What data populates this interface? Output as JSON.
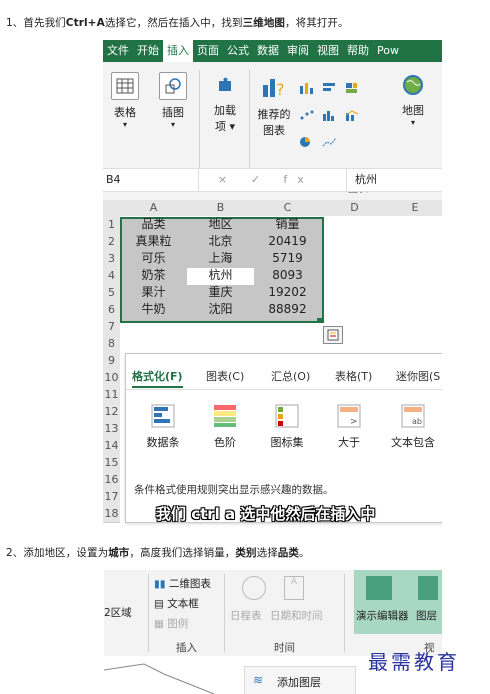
{
  "step1": {
    "prefix": "1、首先我们",
    "key1": "Ctrl+A",
    "mid1": "选择它，然后在插入中，找到",
    "key2": "三维地图",
    "suffix": "，将其打开。"
  },
  "ribbon_tabs": [
    "文件",
    "开始",
    "插入",
    "页面",
    "公式",
    "数据",
    "审阅",
    "视图",
    "帮助",
    "Pow"
  ],
  "ribbon": {
    "table": "表格",
    "illustration": "插图",
    "addin_1": "加载",
    "addin_2": "项 ▾",
    "recommended_chart_1": "推荐的",
    "recommended_chart_2": "图表",
    "map": "地图",
    "group_chart": "图表"
  },
  "formula_bar": {
    "namebox": "B4",
    "fx": "× ✓ fx",
    "value": "杭州"
  },
  "columns": [
    "A",
    "B",
    "C",
    "D",
    "E"
  ],
  "rows": [
    "1",
    "2",
    "3",
    "4",
    "5",
    "6",
    "7",
    "8",
    "9",
    "10",
    "11",
    "12",
    "13",
    "14",
    "15",
    "16",
    "17",
    "18"
  ],
  "table": [
    [
      "品类",
      "地区",
      "销量"
    ],
    [
      "真果粒",
      "北京",
      "20419"
    ],
    [
      "可乐",
      "上海",
      "5719"
    ],
    [
      "奶茶",
      "杭州",
      "8093"
    ],
    [
      "果汁",
      "重庆",
      "19202"
    ],
    [
      "牛奶",
      "沈阳",
      "88892"
    ]
  ],
  "quick_analysis": {
    "tabs": [
      "格式化(F)",
      "图表(C)",
      "汇总(O)",
      "表格(T)",
      "迷你图(S"
    ],
    "options": [
      "数据条",
      "色阶",
      "图标集",
      "大于",
      "文本包含"
    ],
    "description": "条件格式使用规则突出显示感兴趣的数据。"
  },
  "subtitle": "我们 ctrl a 选中他然后在插入中",
  "step2": {
    "prefix": "2、添加地区，设置为",
    "key1": "城市",
    "mid1": "，高度我们选择销量，",
    "key2": "类别",
    "mid2": "选择",
    "key3": "品类",
    "suffix": "。"
  },
  "shot2": {
    "region": "2区域",
    "chart_2d": "二维图表",
    "textbox": "文本框",
    "legend": "图例",
    "group_insert": "插入",
    "timeline": "日程表",
    "date_time": "日期和时间",
    "group_time": "时间",
    "tour_editor": "演示编辑器",
    "layer": "图层",
    "view_short": "视"
  },
  "add_layer": "添加图层",
  "watermark": "最需教育",
  "colors": {
    "excel_green": "#217346",
    "selection_gray": "#c6c6c6",
    "watermark": "#2a33a0"
  }
}
